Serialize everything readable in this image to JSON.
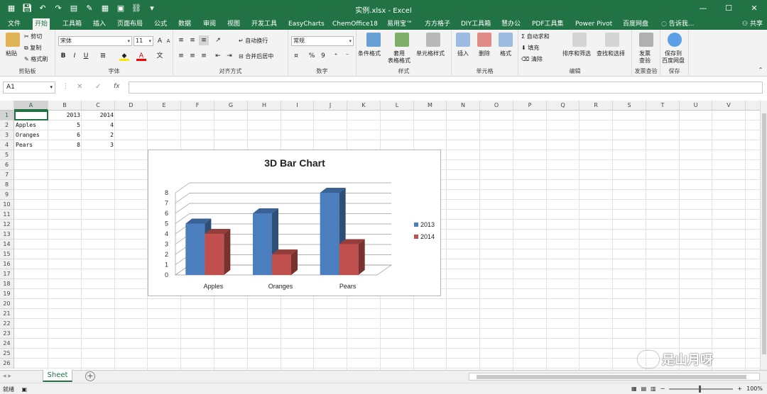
{
  "window": {
    "title": "实例.xlsx - Excel",
    "share_label": "共享",
    "tell_me": "告诉我..."
  },
  "tabs": [
    "文件",
    "开始",
    "工具箱",
    "插入",
    "页面布局",
    "公式",
    "数据",
    "审阅",
    "视图",
    "开发工具",
    "EasyCharts",
    "ChemOffice18",
    "易用宝™",
    "方方格子",
    "DIY工具箱",
    "慧办公",
    "PDF工具集",
    "Power Pivot",
    "百度网盘"
  ],
  "active_tab": "开始",
  "ribbon": {
    "clipboard": {
      "paste": "粘贴",
      "cut": "剪切",
      "copy": "复制",
      "format_painter": "格式刷",
      "name": "剪贴板"
    },
    "font": {
      "font_name": "宋体",
      "font_size": "11",
      "bold": "B",
      "italic": "I",
      "underline": "U",
      "name": "字体"
    },
    "alignment": {
      "wrap": "自动换行",
      "merge": "合并后居中",
      "name": "对齐方式"
    },
    "number": {
      "format": "常规",
      "percent": "%",
      "comma": "9",
      "name": "数字"
    },
    "styles": {
      "conditional": "条件格式",
      "table_fmt_1": "套用",
      "table_fmt_2": "表格格式",
      "cell_styles": "单元格样式",
      "name": "样式"
    },
    "cells": {
      "insert": "插入",
      "delete": "删除",
      "format": "格式",
      "name": "单元格"
    },
    "editing": {
      "autosum": "自动求和",
      "fill": "填充",
      "clear": "清除",
      "sort": "排序和筛选",
      "find": "查找和选择",
      "name": "编辑"
    },
    "invoice": {
      "label_1": "发票",
      "label_2": "查验",
      "name": "发票查验"
    },
    "save": {
      "label_1": "保存到",
      "label_2": "百度网盘",
      "name": "保存"
    }
  },
  "formula_bar": {
    "name_box": "A1",
    "fx": "fx",
    "formula": ""
  },
  "columns": [
    "A",
    "B",
    "C",
    "D",
    "E",
    "F",
    "G",
    "H",
    "I",
    "J",
    "K",
    "L",
    "M",
    "N",
    "O",
    "P",
    "Q",
    "R",
    "S",
    "T",
    "U",
    "V"
  ],
  "rows": [
    "1",
    "2",
    "3",
    "4",
    "5",
    "6",
    "7",
    "8",
    "9",
    "10",
    "11",
    "12",
    "13",
    "14",
    "15",
    "16",
    "17",
    "18",
    "19",
    "20",
    "21",
    "22",
    "23",
    "24",
    "25",
    "26"
  ],
  "cells": {
    "B1": "2013",
    "C1": "2014",
    "A2": "Apples",
    "B2": "5",
    "C2": "4",
    "A3": "Oranges",
    "B3": "6",
    "C3": "2",
    "A4": "Pears",
    "B4": "8",
    "C4": "3"
  },
  "chart_data": {
    "type": "bar",
    "title": "3D Bar Chart",
    "categories": [
      "Apples",
      "Oranges",
      "Pears"
    ],
    "series": [
      {
        "name": "2013",
        "values": [
          5,
          6,
          8
        ],
        "color": "#4a7ebf"
      },
      {
        "name": "2014",
        "values": [
          4,
          2,
          3
        ],
        "color": "#c0504d"
      }
    ],
    "ylim": [
      0,
      8
    ],
    "yticks": [
      "0",
      "1",
      "2",
      "3",
      "4",
      "5",
      "6",
      "7",
      "8"
    ],
    "grid": true,
    "legend": "right",
    "style": "3d"
  },
  "sheet": {
    "tab": "Sheet",
    "add": "+"
  },
  "status": {
    "ready": "就绪",
    "zoom": "100%"
  },
  "watermark": {
    "text": "是山月呀"
  },
  "colors": {
    "excel_green": "#217346",
    "series_2013": "#4a7ebf",
    "series_2014": "#c0504d"
  }
}
